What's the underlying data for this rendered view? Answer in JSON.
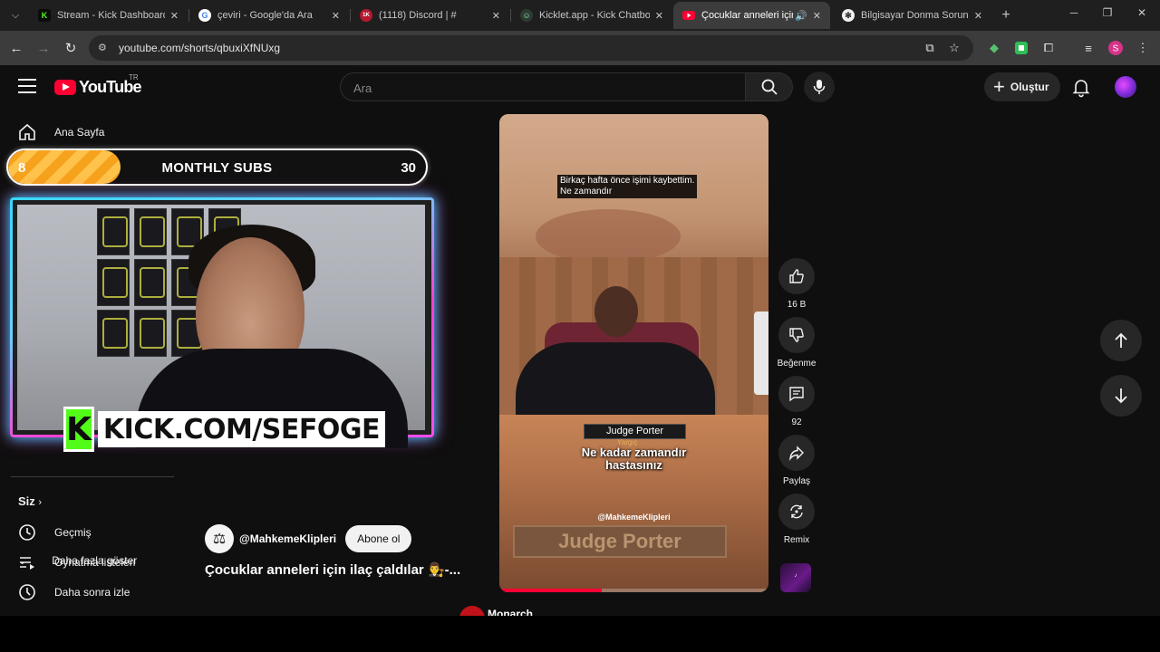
{
  "browser": {
    "tabs": [
      {
        "title": "Stream - Kick Dashboard",
        "favicon": "kick-icon",
        "color": "#53fc18"
      },
      {
        "title": "çeviri - Google'da Ara",
        "favicon": "google-icon",
        "color": "#4285f4"
      },
      {
        "title": "(1118) Discord | #",
        "favicon": "discord-icon",
        "color": "#b5172f"
      },
      {
        "title": "Kicklet.app - Kick Chatbot",
        "favicon": "kicklet-icon",
        "color": "#3a8a5a"
      },
      {
        "title": "Çocuklar anneleri için i",
        "favicon": "youtube-icon",
        "color": "#ff0033",
        "active": true
      },
      {
        "title": "Bilgisayar Donma Sorunu",
        "favicon": "chatgpt-icon",
        "color": "#e8e8e8"
      }
    ],
    "url": "youtube.com/shorts/qbuxiXfNUxg"
  },
  "youtube": {
    "logo_text": "YouTube",
    "country_code": "TR",
    "search_placeholder": "Ara",
    "create_label": "Oluştur"
  },
  "sidebar": {
    "home": "Ana Sayfa",
    "show_more": "Daha fazla göster",
    "you_heading": "Siz",
    "history": "Geçmiş",
    "playlists": "Oynatma listeleri",
    "watch_later": "Daha sonra izle"
  },
  "overlay": {
    "subs_current": "8",
    "subs_label": "MONTHLY SUBS",
    "subs_goal": "30",
    "subs_progress_fraction": 0.27,
    "kick_logo_letter": "K",
    "kick_url": "KICK.COM/SEFOGE"
  },
  "short": {
    "subtitle_top_line1": "Birkaç hafta önce işimi kaybettim.",
    "subtitle_top_line2": "Ne zamandır",
    "name_tag": "Judge Porter",
    "name_role": "Yargıç",
    "subtitle_mid_line1": "Ne kadar zamandır",
    "subtitle_mid_line2": "hastasınız",
    "watermark": "@MahkemeKlipleri",
    "blurred_plate": "Judge Porter",
    "progress_fraction": 0.38,
    "channel_name": "@MahkemeKlipleri",
    "subscribe_label": "Abone ol",
    "title": "Çocuklar anneleri için ilaç çaldılar 👨‍⚖️-...",
    "sound_label": "Monarch"
  },
  "actions": {
    "like_count": "16 B",
    "dislike_label": "Beğenme",
    "comment_count": "92",
    "share_label": "Paylaş",
    "remix_label": "Remix"
  }
}
